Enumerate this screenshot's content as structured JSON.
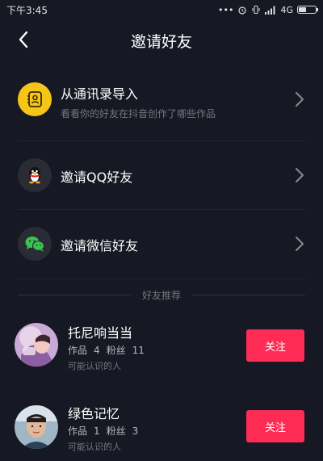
{
  "status_bar": {
    "time": "下午3:45",
    "network": "4G",
    "icons": [
      "dots-icon",
      "alarm-icon",
      "vibrate-icon",
      "signal-icon",
      "battery-icon"
    ]
  },
  "header": {
    "title": "邀请好友",
    "back_icon": "chevron-left-icon"
  },
  "options": [
    {
      "title": "从通讯录导入",
      "subtitle": "看看你的好友在抖音创作了哪些作品",
      "icon": "contacts-icon",
      "icon_color": "#f5c518"
    },
    {
      "title": "邀请QQ好友",
      "icon": "qq-penguin-icon",
      "icon_color": "#2a2c35"
    },
    {
      "title": "邀请微信好友",
      "icon": "wechat-icon",
      "icon_color": "#2a2c35"
    }
  ],
  "section_label": "好友推荐",
  "recommendations": [
    {
      "name": "托尼响当当",
      "works_label": "作品",
      "works": "4",
      "fans_label": "粉丝",
      "fans": "11",
      "note": "可能认识的人",
      "button": "关注"
    },
    {
      "name": "绿色记忆",
      "works_label": "作品",
      "works": "1",
      "fans_label": "粉丝",
      "fans": "3",
      "note": "可能认识的人",
      "button": "关注"
    }
  ],
  "colors": {
    "background": "#161823",
    "accent": "#fe2c55",
    "muted": "#75767c"
  }
}
